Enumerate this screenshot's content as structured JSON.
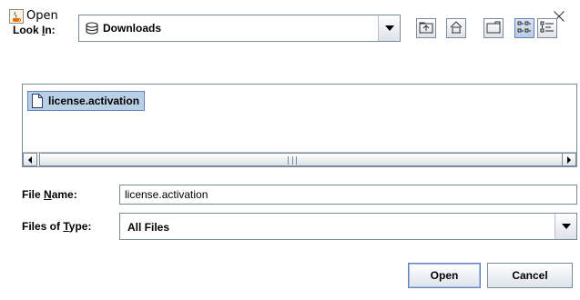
{
  "window": {
    "title": "Open",
    "app_icon": "java-cup-icon",
    "close_icon": "close-icon"
  },
  "look_in": {
    "label_pre": "Look ",
    "label_mnemonic": "I",
    "label_post": "n:",
    "value": "Downloads",
    "icon": "disk-icon"
  },
  "toolbar": {
    "buttons": [
      "up-one-level-icon",
      "home-icon",
      "new-folder-icon",
      "list-view-icon",
      "details-view-icon"
    ],
    "selected": "list-view-icon"
  },
  "file_list": {
    "items": [
      {
        "name": "license.activation",
        "icon": "file-icon",
        "selected": true
      }
    ]
  },
  "file_name": {
    "label_pre": "File ",
    "label_mnemonic": "N",
    "label_post": "ame:",
    "value": "license.activation"
  },
  "file_type": {
    "label_pre": "Files of ",
    "label_mnemonic": "T",
    "label_post": "ype:",
    "value": "All Files"
  },
  "buttons": {
    "open_label": "Open",
    "cancel_label": "Cancel"
  },
  "colors": {
    "selection_bg": "#b8cfe5",
    "selection_border": "#6382bf",
    "dialog_bg": "#eeeeee"
  }
}
